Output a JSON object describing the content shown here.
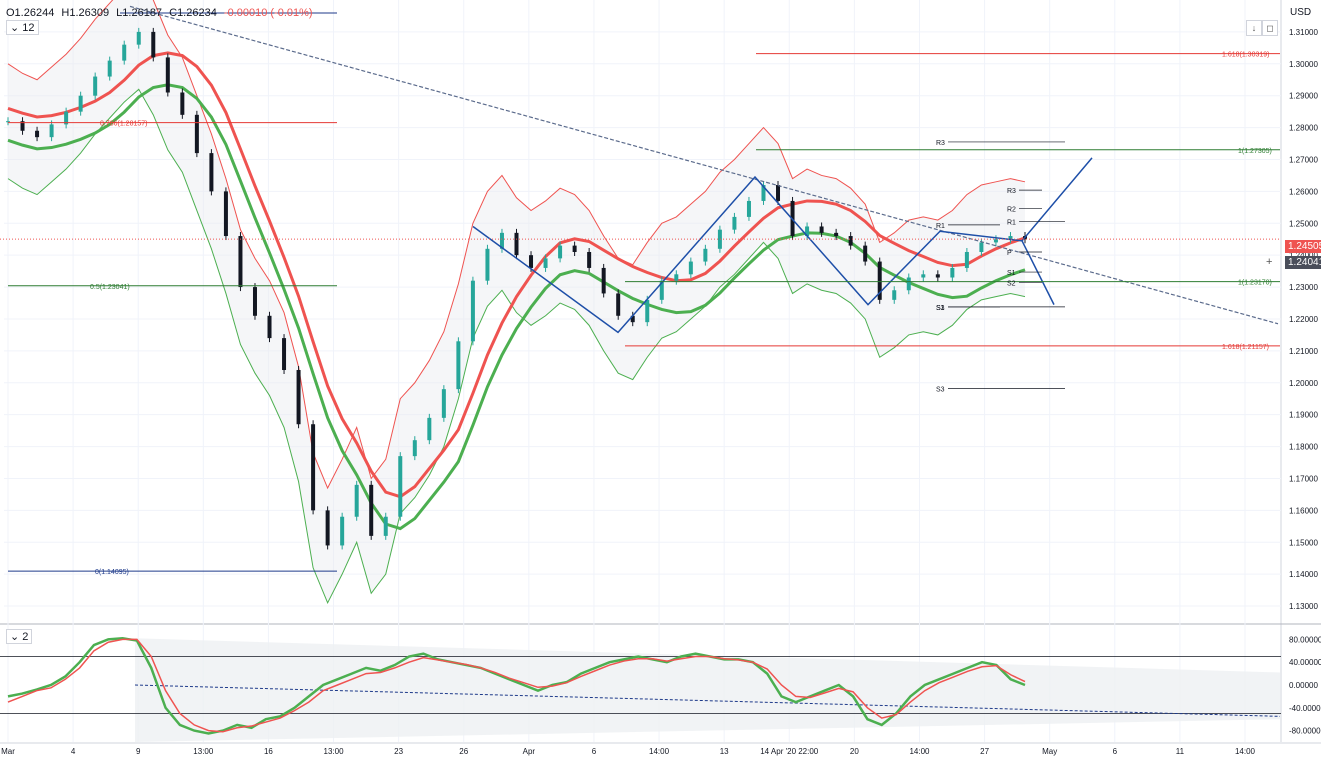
{
  "legend": {
    "open": "O1.26244",
    "high": "H1.26309",
    "low": "L1.26187",
    "close": "C1.26234",
    "change": "-0.00010 (-0.01%)",
    "interval": "12",
    "oscillator_count": "2"
  },
  "currency": "USD",
  "price_labels": {
    "last": "1.24505",
    "crosshair": "1.24041"
  },
  "colors": {
    "up": "#26a69a",
    "down": "#131722",
    "upper_band": "#ef5350",
    "lower_band": "#4caf50",
    "trend": "#1e3a8a",
    "fib_red": "#e53935",
    "fib_green": "#2e7d32",
    "fib_blue": "#1e3a8a"
  },
  "chart_data": [
    {
      "type": "line",
      "ylim": [
        1.125,
        1.32
      ],
      "y_ticks": [
        "1.31000",
        "1.30000",
        "1.29000",
        "1.28000",
        "1.27000",
        "1.26000",
        "1.25000",
        "1.24000",
        "1.23000",
        "1.22000",
        "1.21000",
        "1.20000",
        "1.19000",
        "1.18000",
        "1.17000",
        "1.16000",
        "1.15000",
        "1.14000",
        "1.13000"
      ],
      "x_ticks": [
        "Mar",
        "4",
        "9",
        "13:00",
        "16",
        "13:00",
        "23",
        "26",
        "Apr",
        "6",
        "14:00",
        "13",
        "14 Apr '20  22:00",
        "20",
        "14:00",
        "27",
        "May",
        "6",
        "11",
        "14:00"
      ],
      "series": [
        {
          "values": [
            1.282,
            1.279,
            1.277,
            1.281,
            1.285,
            1.29,
            1.296,
            1.301,
            1.306,
            1.31,
            1.302,
            1.291,
            1.284,
            1.272,
            1.26,
            1.246,
            1.23,
            1.221,
            1.214,
            1.204,
            1.187,
            1.16,
            1.149,
            1.158,
            1.168,
            1.152,
            1.158,
            1.177,
            1.182,
            1.189,
            1.198,
            1.213,
            1.232,
            1.242,
            1.247,
            1.24,
            1.236,
            1.239,
            1.243,
            1.241,
            1.236,
            1.228,
            1.221,
            1.219,
            1.226,
            1.232,
            1.234,
            1.238,
            1.242,
            1.248,
            1.252,
            1.257,
            1.262,
            1.257,
            1.246,
            1.249,
            1.247,
            1.246,
            1.243,
            1.238,
            1.226,
            1.229,
            1.233,
            1.234,
            1.233,
            1.236,
            1.241,
            1.244,
            1.245,
            1.246,
            1.245
          ]
        }
      ],
      "fib_levels": [
        {
          "label": "0.786(1.28157)",
          "value": 1.28157
        },
        {
          "label": "0.5(1.23041)",
          "value": 1.23041
        },
        {
          "label": "0(1.14095)",
          "value": 1.14095
        },
        {
          "label": "1.618(1.30319)",
          "value": 1.30319
        },
        {
          "label": "1(1.27305)",
          "value": 1.27305
        },
        {
          "label": "1(1.23170)",
          "value": 1.2317
        },
        {
          "label": "1.618(1.21157)",
          "value": 1.21157
        }
      ],
      "pivot_labels": [
        "R3",
        "R3",
        "R2",
        "R1",
        "R1",
        "P",
        "S1",
        "S2",
        "S3",
        "S1",
        "S3"
      ]
    },
    {
      "type": "line",
      "ylim": [
        -100,
        100
      ],
      "y_ticks": [
        "80.00000",
        "40.00000",
        "0.00000",
        "-40.00000",
        "-80.00000"
      ],
      "series": [
        {
          "values": [
            -20,
            -15,
            -8,
            0,
            15,
            40,
            70,
            80,
            82,
            78,
            30,
            -40,
            -70,
            -80,
            -85,
            -80,
            -70,
            -75,
            -60,
            -55,
            -40,
            -20,
            0,
            10,
            20,
            30,
            25,
            35,
            50,
            55,
            45,
            40,
            35,
            30,
            20,
            10,
            0,
            -10,
            0,
            5,
            20,
            30,
            40,
            45,
            50,
            45,
            40,
            50,
            55,
            50,
            45,
            45,
            40,
            20,
            -20,
            -30,
            -20,
            -10,
            0,
            -20,
            -60,
            -70,
            -50,
            -20,
            0,
            10,
            20,
            30,
            40,
            35,
            10,
            0
          ]
        },
        {
          "values": [
            -30,
            -20,
            -10,
            -5,
            10,
            30,
            60,
            75,
            80,
            80,
            50,
            -10,
            -50,
            -70,
            -80,
            -82,
            -75,
            -72,
            -65,
            -58,
            -45,
            -30,
            -10,
            0,
            10,
            20,
            22,
            30,
            40,
            48,
            44,
            40,
            36,
            30,
            22,
            12,
            4,
            -4,
            -2,
            4,
            15,
            25,
            35,
            42,
            46,
            46,
            42,
            46,
            50,
            50,
            46,
            44,
            40,
            28,
            0,
            -20,
            -22,
            -14,
            -6,
            -12,
            -40,
            -58,
            -52,
            -30,
            -10,
            4,
            14,
            24,
            32,
            34,
            18,
            6
          ]
        }
      ]
    }
  ]
}
